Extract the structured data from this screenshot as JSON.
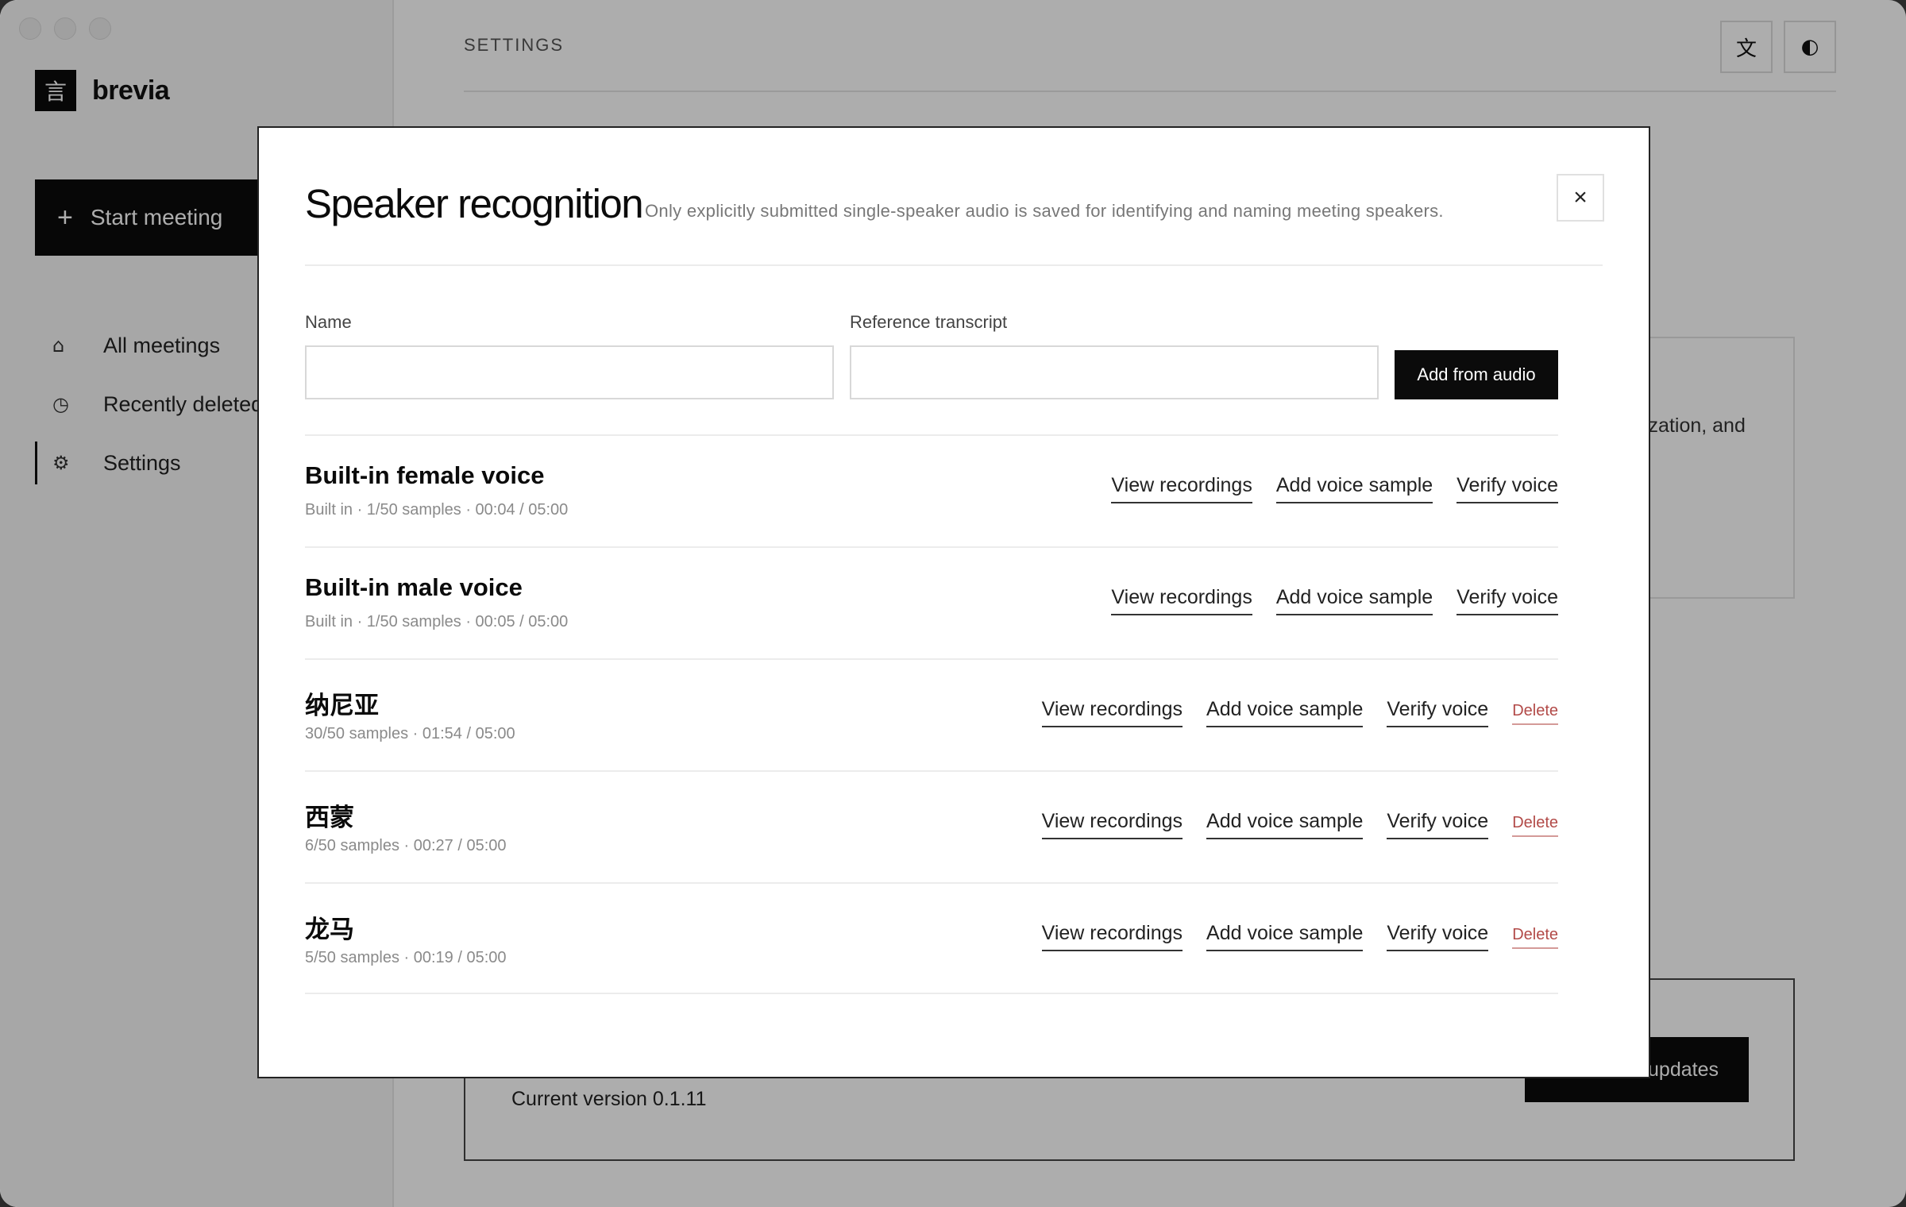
{
  "app": {
    "brand_name": "brevia",
    "brand_logo_glyph": "言",
    "start_meeting": "Start meeting",
    "nav": [
      {
        "label": "All meetings",
        "icon": "home-icon",
        "glyph": "⌂"
      },
      {
        "label": "Recently deleted",
        "icon": "clock-icon",
        "glyph": "◷"
      },
      {
        "label": "Settings",
        "icon": "gear-icon",
        "glyph": "⚙"
      }
    ],
    "page_title": "SETTINGS",
    "language_glyph": "文",
    "theme_glyph": "◐",
    "card_text_fragment": "ization, and",
    "current_version": "Current version 0.1.11",
    "updates_button": "updates"
  },
  "modal": {
    "title": "Speaker recognition",
    "subtitle": "Only explicitly submitted single-speaker audio is saved for identifying and naming meeting speakers.",
    "close_glyph": "×",
    "name_label": "Name",
    "name_value": "",
    "transcript_label": "Reference transcript",
    "transcript_value": "",
    "add_from_audio": "Add from audio",
    "actions": {
      "view": "View recordings",
      "add": "Add voice sample",
      "verify": "Verify voice",
      "delete": "Delete"
    },
    "speakers": [
      {
        "name": "Built-in female voice",
        "meta": "Built in · 1/50 samples · 00:04 / 05:00",
        "deletable": false
      },
      {
        "name": "Built-in male voice",
        "meta": "Built in · 1/50 samples · 00:05 / 05:00",
        "deletable": false
      },
      {
        "name": "纳尼亚",
        "meta": "30/50 samples · 01:54 / 05:00",
        "deletable": true
      },
      {
        "name": "西蒙",
        "meta": "6/50 samples · 00:27 / 05:00",
        "deletable": true
      },
      {
        "name": "龙马",
        "meta": "5/50 samples · 00:19 / 05:00",
        "deletable": true
      }
    ]
  },
  "colors": {
    "accent_black": "#0b0b0b",
    "delete_red": "#b24a48",
    "overlay": "rgba(0,0,0,0.32)"
  }
}
